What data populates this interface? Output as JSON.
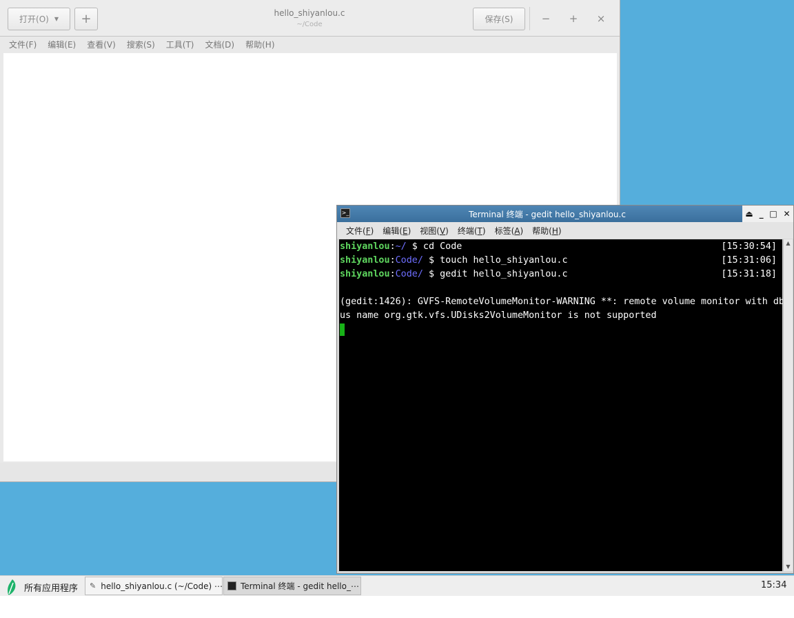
{
  "gedit": {
    "open_label": "打开(O)",
    "new_tab_label": "+",
    "title": "hello_shiyanlou.c",
    "subtitle": "~/Code",
    "save_label": "保存(S)",
    "minimize": "−",
    "maximize": "+",
    "close": "×",
    "menu": [
      "文件(F)",
      "编辑(E)",
      "查看(V)",
      "搜索(S)",
      "工具(T)",
      "文档(D)",
      "帮助(H)"
    ]
  },
  "terminal": {
    "title": "Terminal 终端 - gedit hello_shiyanlou.c",
    "menu": [
      {
        "label": "文件(",
        "key": "F",
        "end": ")"
      },
      {
        "label": "编辑(",
        "key": "E",
        "end": ")"
      },
      {
        "label": "视图(",
        "key": "V",
        "end": ")"
      },
      {
        "label": "终端(",
        "key": "T",
        "end": ")"
      },
      {
        "label": "标签(",
        "key": "A",
        "end": ")"
      },
      {
        "label": "帮助(",
        "key": "H",
        "end": ")"
      }
    ],
    "lines": [
      {
        "user": "shiyanlou",
        "sep": ":",
        "path": "~/",
        "cmd": " $ cd Code",
        "time": "[15:30:54]"
      },
      {
        "user": "shiyanlou",
        "sep": ":",
        "path": "Code/",
        "cmd": " $ touch hello_shiyanlou.c",
        "time": "[15:31:06]"
      },
      {
        "user": "shiyanlou",
        "sep": ":",
        "path": "Code/",
        "cmd": " $ gedit hello_shiyanlou.c",
        "time": "[15:31:18]"
      }
    ],
    "warning_line1": "(gedit:1426): GVFS-RemoteVolumeMonitor-WARNING **: remote volume monitor with db",
    "warning_line2": "us name org.gtk.vfs.UDisks2VolumeMonitor is not supported",
    "colors": {
      "user": "#5fd75f",
      "path": "#6e6eff",
      "cursor": "#18b218"
    }
  },
  "taskbar": {
    "apps_label": "所有应用程序",
    "items": [
      "hello_shiyanlou.c (~/Code) ⋯",
      "Terminal 终端 - gedit hello_⋯"
    ],
    "clock": "15:34"
  }
}
